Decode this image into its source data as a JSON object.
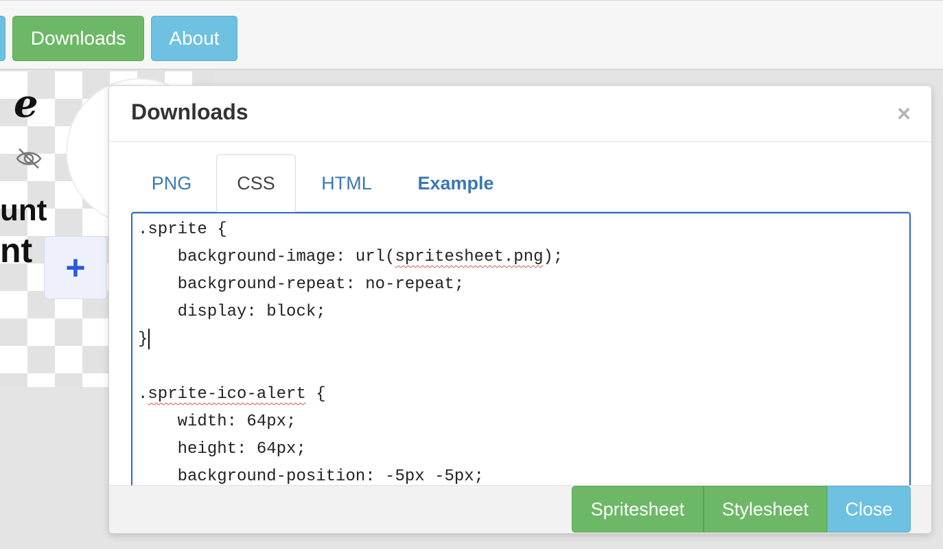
{
  "toolbar": {
    "downloads_label": "Downloads",
    "about_label": "About"
  },
  "background": {
    "text_line1": "unt",
    "text_line2": "nt",
    "plus_symbol": "+"
  },
  "modal": {
    "title": "Downloads",
    "close_symbol": "×",
    "tabs": [
      {
        "label": "PNG",
        "active": false
      },
      {
        "label": "CSS",
        "active": true
      },
      {
        "label": "HTML",
        "active": false
      },
      {
        "label": "Example",
        "active": false
      }
    ],
    "code": {
      "line0": ".sprite {",
      "line1a": "    background-image: url(",
      "line1b": "spritesheet.png",
      "line1c": ");",
      "line2": "    background-repeat: no-repeat;",
      "line3": "    display: block;",
      "line4": "}",
      "line6a": ".",
      "line6b": "sprite-ico-alert",
      "line6c": " {",
      "line7": "    width: 64px;",
      "line8": "    height: 64px;",
      "line9": "    background-position: -5px -5px;"
    },
    "footer": {
      "spritesheet_label": "Spritesheet",
      "stylesheet_label": "Stylesheet",
      "close_label": "Close"
    }
  },
  "colors": {
    "green": "#6db866",
    "blue": "#6ec1e0",
    "link": "#3a78b5",
    "focus": "#2b65c3"
  }
}
